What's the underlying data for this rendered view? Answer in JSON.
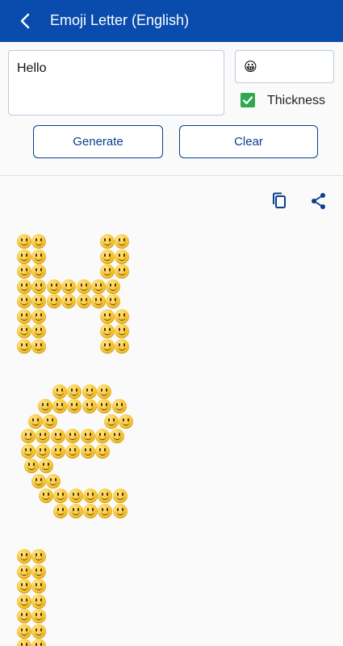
{
  "appbar": {
    "title": "Emoji Letter (English)"
  },
  "form": {
    "text_value": "Hello",
    "emoji_value": "😀",
    "thickness_label": "Thickness",
    "thickness_checked": true
  },
  "buttons": {
    "generate": "Generate",
    "clear": "Clear"
  },
  "output": {
    "icons": [
      "copy-icon",
      "share-icon"
    ],
    "emoji_char": "😀"
  },
  "colors": {
    "appbar": "#0a4cad",
    "button_border": "#0a3e8c",
    "checkbox": "#2fa84f"
  }
}
